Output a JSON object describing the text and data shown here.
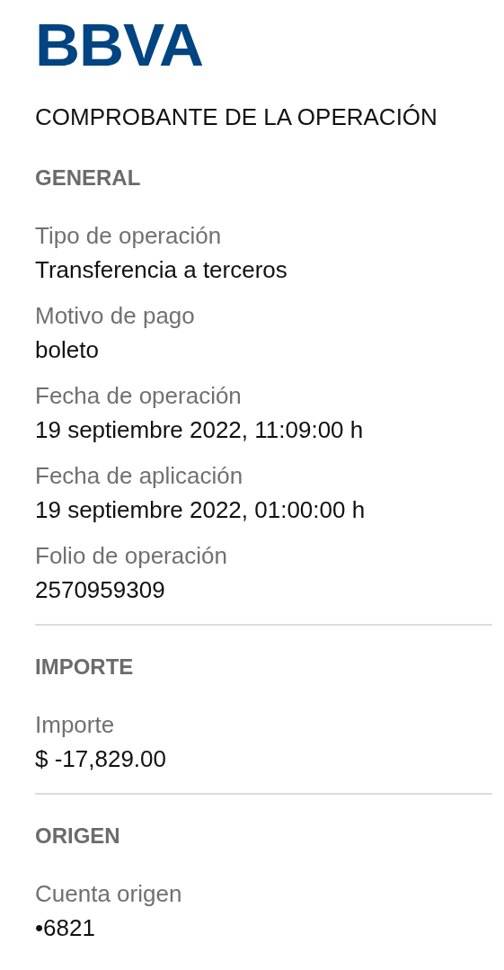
{
  "logo": "BBVA",
  "title": "COMPROBANTE DE LA OPERACIÓN",
  "sections": [
    {
      "heading": "GENERAL",
      "fields": [
        {
          "label": "Tipo de operación",
          "value": "Transferencia a terceros"
        },
        {
          "label": "Motivo de pago",
          "value": "boleto"
        },
        {
          "label": "Fecha de operación",
          "value": "19 septiembre 2022, 11:09:00 h"
        },
        {
          "label": "Fecha de aplicación",
          "value": "19 septiembre 2022, 01:00:00 h"
        },
        {
          "label": "Folio de operación",
          "value": "2570959309"
        }
      ]
    },
    {
      "heading": "IMPORTE",
      "fields": [
        {
          "label": "Importe",
          "value": "$ -17,829.00"
        }
      ]
    },
    {
      "heading": "ORIGEN",
      "fields": [
        {
          "label": "Cuenta origen",
          "value": "•6821"
        }
      ]
    }
  ]
}
